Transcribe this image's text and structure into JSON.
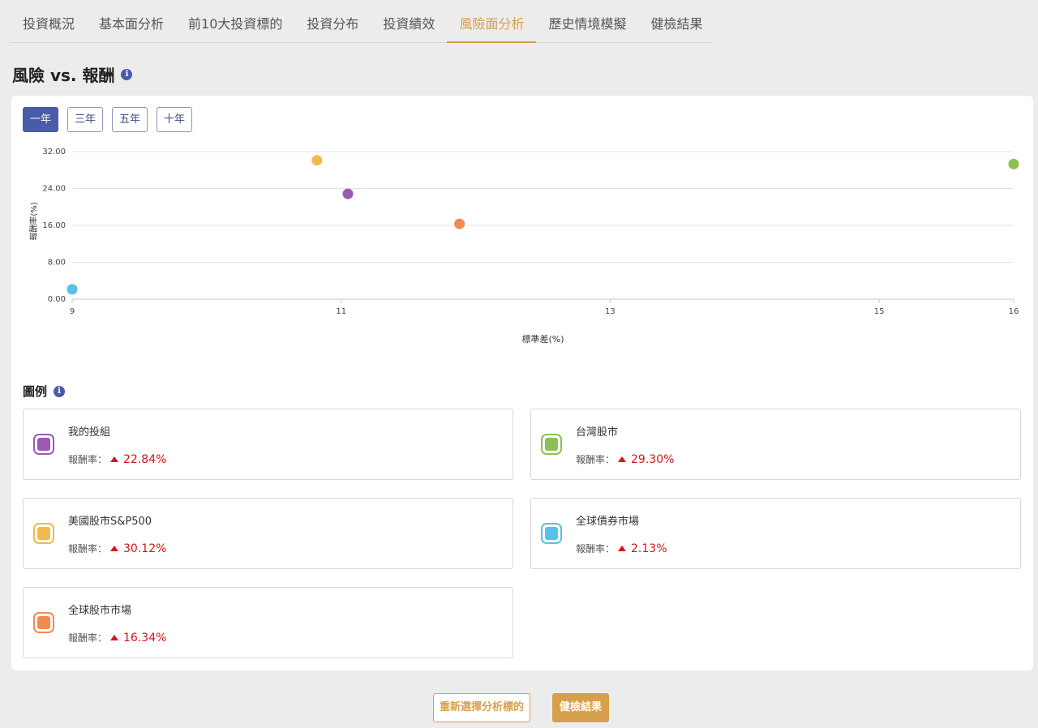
{
  "tabs": [
    {
      "label": "投資概況",
      "active": false
    },
    {
      "label": "基本面分析",
      "active": false
    },
    {
      "label": "前10大投資標的",
      "active": false
    },
    {
      "label": "投資分布",
      "active": false
    },
    {
      "label": "投資績效",
      "active": false
    },
    {
      "label": "風險面分析",
      "active": true
    },
    {
      "label": "歷史情境模擬",
      "active": false
    },
    {
      "label": "健檢結果",
      "active": false
    }
  ],
  "page_title": "風險 vs. 報酬",
  "info_glyph": "i",
  "periods": [
    {
      "label": "一年",
      "active": true
    },
    {
      "label": "三年",
      "active": false
    },
    {
      "label": "五年",
      "active": false
    },
    {
      "label": "十年",
      "active": false
    }
  ],
  "chart_data": {
    "type": "scatter",
    "xlabel": "標準差(%)",
    "ylabel": "報酬率(%)",
    "xlim": [
      9,
      16
    ],
    "ylim": [
      0,
      32
    ],
    "x_ticks": [
      9,
      11,
      13,
      15,
      16
    ],
    "y_ticks": [
      "0.00",
      "8.00",
      "16.00",
      "24.00",
      "32.00"
    ],
    "grid": true,
    "series": [
      {
        "name": "我的投組",
        "x": 11.05,
        "y": 22.84,
        "color": "#9b59b6"
      },
      {
        "name": "台灣股市",
        "x": 16.0,
        "y": 29.3,
        "color": "#8cc152"
      },
      {
        "name": "美國股市S&P500",
        "x": 10.82,
        "y": 30.12,
        "color": "#f5b84c"
      },
      {
        "name": "全球債券市場",
        "x": 9.0,
        "y": 2.13,
        "color": "#59c0e8"
      },
      {
        "name": "全球股市市場",
        "x": 11.88,
        "y": 16.34,
        "color": "#f5894f"
      }
    ]
  },
  "legend": {
    "title": "圖例",
    "return_label": "報酬率：",
    "items": [
      {
        "name": "我的投組",
        "value": "22.84%",
        "color": "#9b59b6"
      },
      {
        "name": "台灣股市",
        "value": "29.30%",
        "color": "#8cc152"
      },
      {
        "name": "美國股市S&P500",
        "value": "30.12%",
        "color": "#f5b84c"
      },
      {
        "name": "全球債券市場",
        "value": "2.13%",
        "color": "#59c0e8"
      },
      {
        "name": "全球股市市場",
        "value": "16.34%",
        "color": "#f5894f"
      }
    ]
  },
  "buttons": {
    "reselect": "重新選擇分析標的",
    "result": "健檢結果"
  }
}
